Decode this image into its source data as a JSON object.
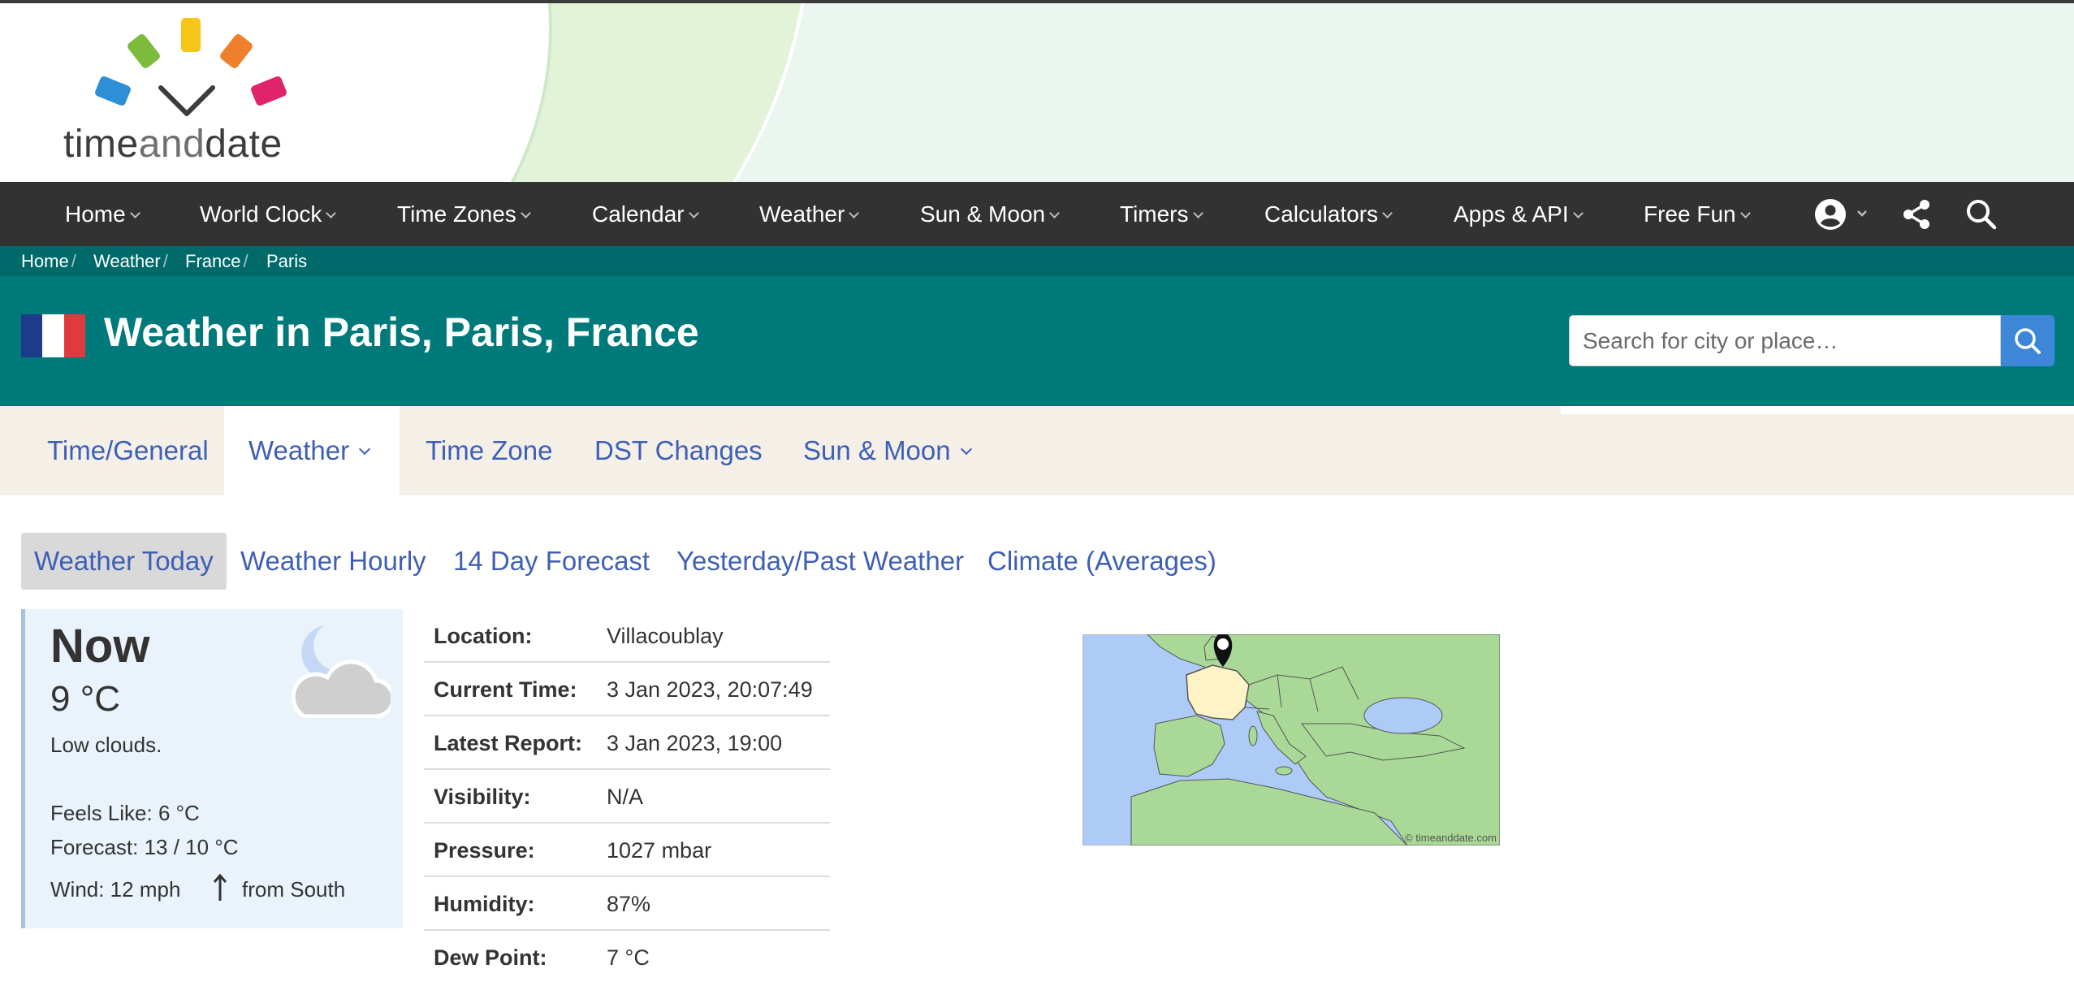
{
  "logo": {
    "text_time": "time",
    "text_and": "and",
    "text_date": "date"
  },
  "nav": {
    "items": [
      {
        "label": "Home"
      },
      {
        "label": "World Clock"
      },
      {
        "label": "Time Zones"
      },
      {
        "label": "Calendar"
      },
      {
        "label": "Weather"
      },
      {
        "label": "Sun & Moon"
      },
      {
        "label": "Timers"
      },
      {
        "label": "Calculators"
      },
      {
        "label": "Apps & API"
      },
      {
        "label": "Free Fun"
      }
    ],
    "icons": [
      "account-icon",
      "share-icon",
      "search-icon"
    ]
  },
  "breadcrumb": [
    "Home",
    "Weather",
    "France",
    "Paris"
  ],
  "header": {
    "title": "Weather in Paris, Paris, France",
    "search_placeholder": "Search for city or place…",
    "flag_colors": [
      "#1e3a8a",
      "#ffffff",
      "#e03a3e"
    ]
  },
  "section_tabs": [
    {
      "label": "Time/General",
      "active": false
    },
    {
      "label": "Weather",
      "active": true
    },
    {
      "label": "Time Zone",
      "active": false
    },
    {
      "label": "DST Changes",
      "active": false
    },
    {
      "label": "Sun & Moon",
      "active": false
    }
  ],
  "sub_tabs": [
    {
      "label": "Weather Today",
      "active": true
    },
    {
      "label": "Weather Hourly",
      "active": false
    },
    {
      "label": "14 Day Forecast",
      "active": false
    },
    {
      "label": "Yesterday/Past Weather",
      "active": false
    },
    {
      "label": "Climate (Averages)",
      "active": false
    }
  ],
  "now": {
    "title": "Now",
    "temp": "9 °C",
    "description": "Low clouds.",
    "feels_like": "Feels Like: 6 °C",
    "forecast": "Forecast: 13 / 10 °C",
    "wind_label": "Wind: 12 mph",
    "wind_direction": "from South",
    "icon": "moon-cloud-icon"
  },
  "details": [
    {
      "label": "Location:",
      "value": "Villacoublay"
    },
    {
      "label": "Current Time:",
      "value": "3 Jan 2023, 20:07:49"
    },
    {
      "label": "Latest Report:",
      "value": "3 Jan 2023, 19:00"
    },
    {
      "label": "Visibility:",
      "value": "N/A"
    },
    {
      "label": "Pressure:",
      "value": "1027 mbar"
    },
    {
      "label": "Humidity:",
      "value": "87%"
    },
    {
      "label": "Dew Point:",
      "value": "7 °C"
    }
  ],
  "map": {
    "credit": "© timeanddate.com"
  },
  "colors": {
    "nav_bg": "#323232",
    "breadcrumb_bg": "#006a6b",
    "header_bg": "#00797a",
    "link": "#3e5fb4",
    "search_button": "#3d86d8"
  }
}
